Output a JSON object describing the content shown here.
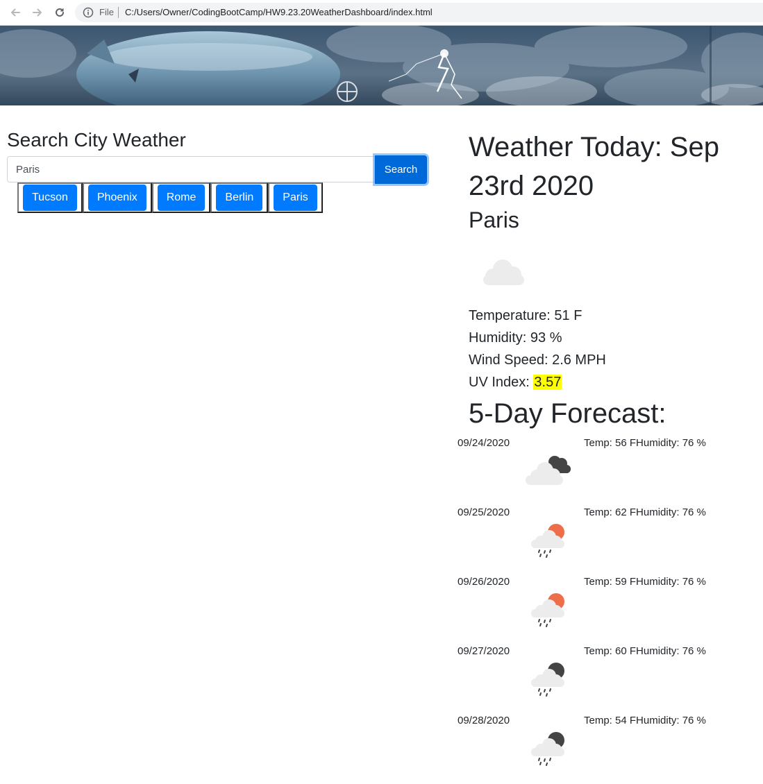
{
  "browser": {
    "scheme_label": "File",
    "url": "C:/Users/Owner/CodingBootCamp/HW9.23.20WeatherDashboard/index.html"
  },
  "search": {
    "title": "Search City Weather",
    "input_value": "Paris",
    "button_label": "Search"
  },
  "history": [
    "Tucson",
    "Phoenix",
    "Rome",
    "Berlin",
    "Paris"
  ],
  "today": {
    "title": "Weather Today: Sep 23rd 2020",
    "city": "Paris",
    "icon": "cloud-icon",
    "temperature": "Temperature: 51 F",
    "humidity": "Humidity: 93 %",
    "wind": "Wind Speed: 2.6 MPH",
    "uv_label": "UV Index:",
    "uv_value": "3.57",
    "uv_color": "#ffff00"
  },
  "forecast": {
    "title": "5-Day Forecast:",
    "days": [
      {
        "date": "09/24/2020",
        "meta": "Temp: 56 FHumidity: 76 %",
        "icon": "broken-clouds-icon"
      },
      {
        "date": "09/25/2020",
        "meta": "Temp: 62 FHumidity: 76 %",
        "icon": "day-rain-icon"
      },
      {
        "date": "09/26/2020",
        "meta": "Temp: 59 FHumidity: 76 %",
        "icon": "day-rain-icon"
      },
      {
        "date": "09/27/2020",
        "meta": "Temp: 60 FHumidity: 76 %",
        "icon": "night-rain-icon"
      },
      {
        "date": "09/28/2020",
        "meta": "Temp: 54 FHumidity: 76 %",
        "icon": "night-rain-icon"
      }
    ]
  },
  "colors": {
    "primary": "#007bff",
    "search_button": "#0069d9",
    "uv_highlight": "#ffff00"
  }
}
